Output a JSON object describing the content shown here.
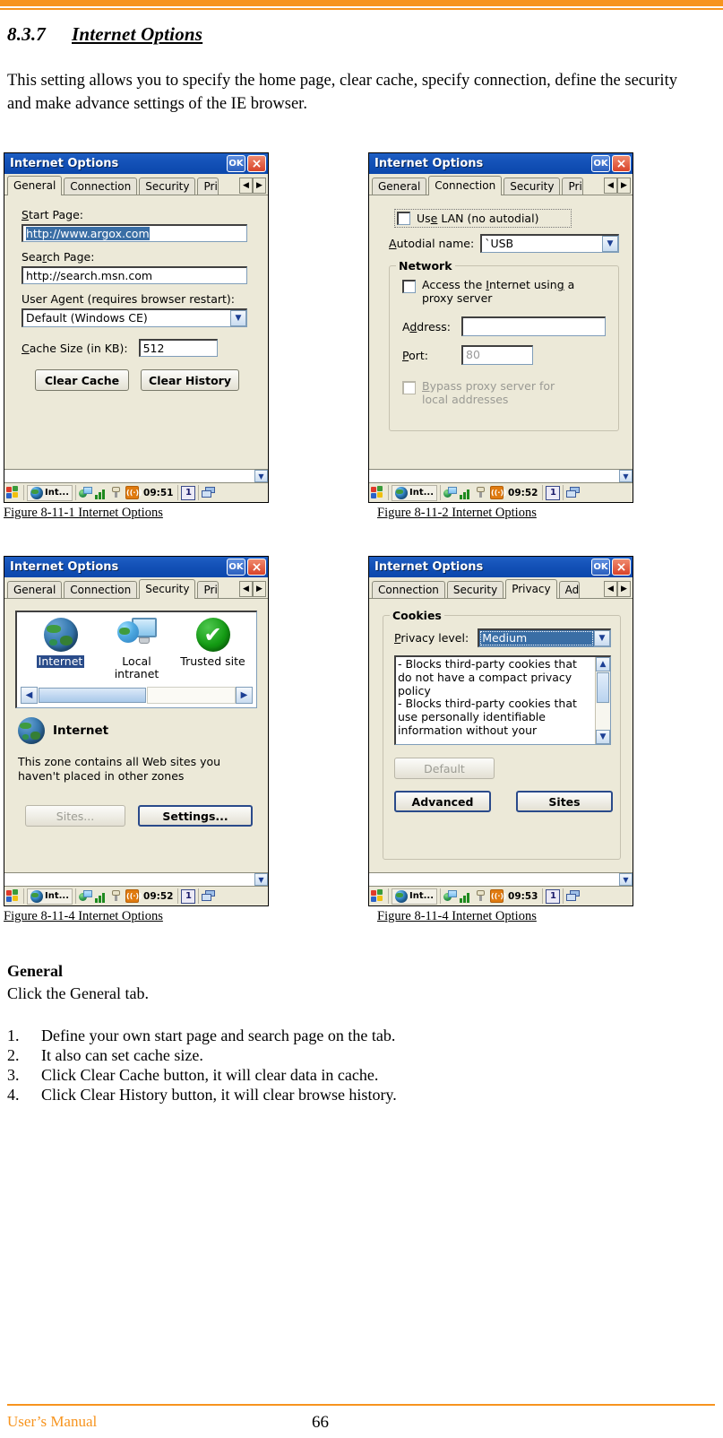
{
  "page": {
    "section_number": "8.3.7",
    "section_title": "Internet Options",
    "intro": "This setting allows you to specify the home page, clear cache, specify connection, define the security and make advance settings of the IE browser.",
    "footer_left": "User’s Manual",
    "footer_page": "66"
  },
  "accent_color": "#F7941E",
  "figures": [
    {
      "caption": "Figure 8-11-1 Internet Options"
    },
    {
      "caption": "Figure 8-11-2 Internet Options"
    },
    {
      "caption": "Figure 8-11-4 Internet Options"
    },
    {
      "caption": "Figure 8-11-4 Internet Options"
    }
  ],
  "dialog_common": {
    "title": "Internet Options",
    "ok_label": "OK",
    "close_label": "×",
    "prev_arrow": "◀",
    "next_arrow": "▶",
    "scroll_down": "⌵"
  },
  "taskbar": {
    "start_icon": "windows-start-icon",
    "app_label": "Int...",
    "app_icon": "internet-explorer-icon",
    "tray_icons": [
      "network-icon",
      "signal-bars-icon",
      "plug-icon",
      "wifi-icon"
    ],
    "count_badge": "1",
    "switch_icon": "window-switch-icon",
    "times": [
      "09:51",
      "09:52",
      "09:52",
      "09:53"
    ]
  },
  "general_tab": {
    "tabs": [
      "General",
      "Connection",
      "Security",
      "Pri"
    ],
    "active_tab": "General",
    "start_page_label": "Start Page:",
    "start_page_value": "http://www.argox.com",
    "search_page_label": "Search Page:",
    "search_page_value": "http://search.msn.com",
    "user_agent_label": "User Agent (requires browser restart):",
    "user_agent_value": "Default (Windows CE)",
    "cache_size_label": "Cache Size (in KB):",
    "cache_size_value": "512",
    "clear_cache_label": "Clear Cache",
    "clear_history_label": "Clear History"
  },
  "connection_tab": {
    "tabs": [
      "General",
      "Connection",
      "Security",
      "Pri"
    ],
    "active_tab": "Connection",
    "use_lan_label": "Use LAN (no autodial)",
    "use_lan_checked": false,
    "autodial_label": "Autodial name:",
    "autodial_value": "`USB",
    "network_group": "Network",
    "proxy_label": "Access the Internet using a proxy server",
    "proxy_checked": false,
    "address_label": "Address:",
    "address_value": "",
    "port_label": "Port:",
    "port_value": "80",
    "bypass_label": "Bypass proxy server for local addresses",
    "bypass_checked": false
  },
  "security_tab": {
    "tabs": [
      "General",
      "Connection",
      "Security",
      "Pri"
    ],
    "active_tab": "Security",
    "zones": [
      {
        "name": "Internet",
        "icon": "globe-icon",
        "selected": true
      },
      {
        "name": "Local intranet",
        "icon": "local-intranet-icon",
        "selected": false
      },
      {
        "name": "Trusted site",
        "icon": "trusted-sites-check-icon",
        "selected": false
      }
    ],
    "selected_zone_title": "Internet",
    "selected_zone_desc": "This zone contains all Web sites you haven't placed in other zones",
    "sites_label": "Sites...",
    "sites_disabled": true,
    "settings_label": "Settings..."
  },
  "privacy_tab": {
    "tabs": [
      "Connection",
      "Security",
      "Privacy",
      "Ad"
    ],
    "active_tab": "Privacy",
    "cookies_group": "Cookies",
    "privacy_level_label": "Privacy level:",
    "privacy_level_value": "Medium",
    "description_lines": [
      "- Blocks third-party cookies that",
      "do not have a compact privacy",
      "policy",
      "- Blocks third-party cookies that",
      "use personally identifiable",
      "information without your"
    ],
    "default_label": "Default",
    "default_disabled": true,
    "advanced_label": "Advanced",
    "sites_label": "Sites"
  },
  "body": {
    "heading": "General",
    "lead": "Click the General tab.",
    "steps": [
      {
        "n": "1.",
        "text": "Define your own start page and search page on the tab."
      },
      {
        "n": "2.",
        "text": "It also can set cache size."
      },
      {
        "n": "3.",
        "text": "Click Clear Cache button, it will clear data in cache."
      },
      {
        "n": "4.",
        "text": "Click Clear History button, it will clear browse history."
      }
    ]
  }
}
